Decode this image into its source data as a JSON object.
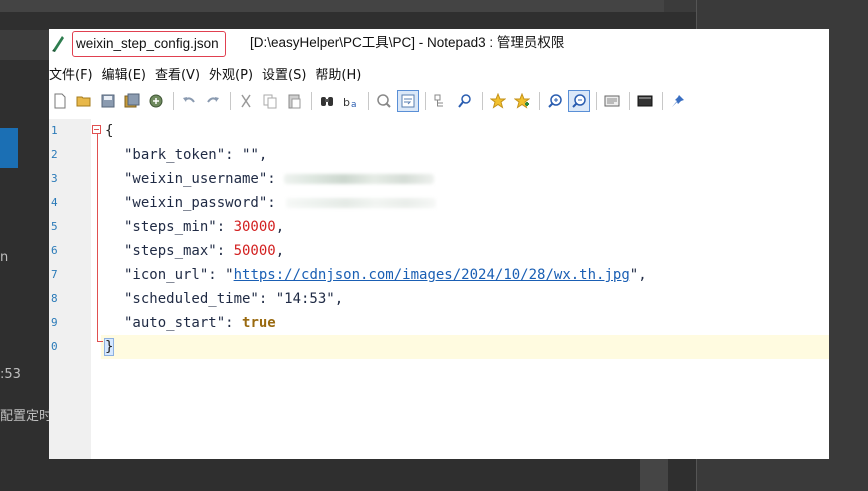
{
  "background": {
    "side_text_1": "n",
    "side_text_2": ":53",
    "side_text_3": "配置定时"
  },
  "window": {
    "title_filename": "weixin_step_config.json",
    "title_rest": "[D:\\easyHelper\\PC工具\\PC] - Notepad3 : 管理员权限"
  },
  "menu": [
    {
      "label": "文件(F)"
    },
    {
      "label": "编辑(E)"
    },
    {
      "label": "查看(V)"
    },
    {
      "label": "外观(P)"
    },
    {
      "label": "设置(S)"
    },
    {
      "label": "帮助(H)"
    }
  ],
  "toolbar": [
    {
      "name": "new-file-icon"
    },
    {
      "name": "open-folder-icon"
    },
    {
      "name": "save-icon"
    },
    {
      "name": "save-all-icon"
    },
    {
      "name": "browse-icon"
    },
    {
      "name": "undo-icon"
    },
    {
      "name": "redo-icon"
    },
    {
      "name": "cut-icon"
    },
    {
      "name": "copy-icon"
    },
    {
      "name": "paste-icon"
    },
    {
      "name": "find-icon"
    },
    {
      "name": "replace-icon"
    },
    {
      "name": "goto-icon"
    },
    {
      "name": "word-wrap-icon",
      "active": true
    },
    {
      "name": "collapse-icon"
    },
    {
      "name": "find-in-files-icon"
    },
    {
      "name": "favorite-icon"
    },
    {
      "name": "add-favorite-icon"
    },
    {
      "name": "zoom-in-icon"
    },
    {
      "name": "zoom-out-icon",
      "active": true
    },
    {
      "name": "scheme-icon"
    },
    {
      "name": "console-icon"
    },
    {
      "name": "pin-icon"
    }
  ],
  "editor": {
    "line_numbers": [
      "1",
      "2",
      "3",
      "4",
      "5",
      "6",
      "7",
      "8",
      "9",
      "0"
    ],
    "open_brace": "{",
    "close_brace": "}",
    "lines": [
      {
        "key": "\"bark_token\"",
        "sep": ": ",
        "value": "\"\"",
        "suffix": ","
      },
      {
        "key": "\"weixin_username\"",
        "sep": ": "
      },
      {
        "key": "\"weixin_password\"",
        "sep": ":"
      },
      {
        "key": "\"steps_min\"",
        "sep": ": ",
        "value": "30000",
        "suffix": ","
      },
      {
        "key": "\"steps_max\"",
        "sep": ": ",
        "value": "50000",
        "suffix": ","
      },
      {
        "key": "\"icon_url\"",
        "sep": ": ",
        "quote_open": "\"",
        "value": "https://cdnjson.com/images/2024/10/28/wx.th.jpg",
        "quote_close": "\"",
        "suffix": ","
      },
      {
        "key": "\"scheduled_time\"",
        "sep": ": ",
        "value": "\"14:53\"",
        "suffix": ","
      },
      {
        "key": "\"auto_start\"",
        "sep": ": ",
        "value": "true"
      }
    ]
  }
}
